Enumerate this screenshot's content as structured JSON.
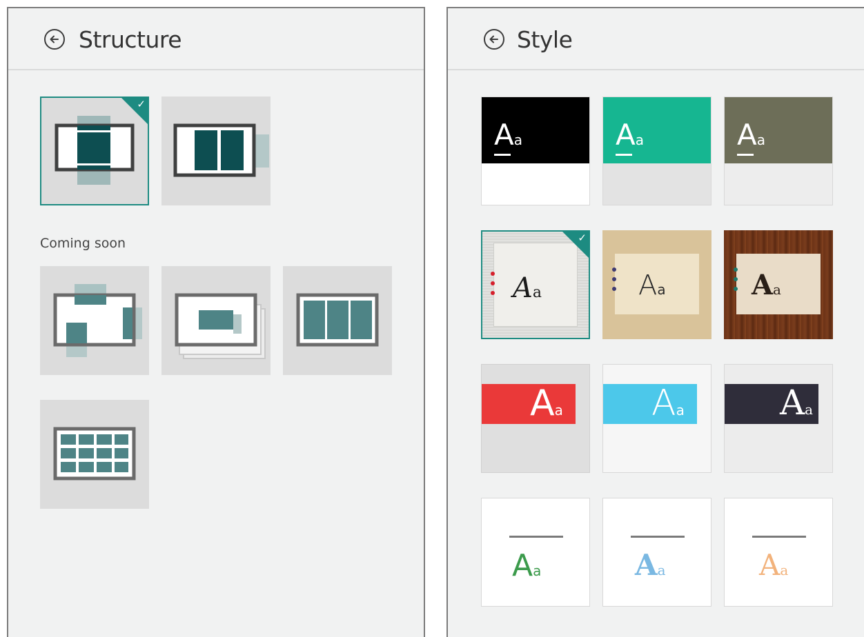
{
  "structure_panel": {
    "title": "Structure",
    "back_icon": "back-arrow-icon",
    "section_label": "Coming soon",
    "layouts": [
      {
        "name": "layout-vertical-center",
        "selected": true
      },
      {
        "name": "layout-horizontal-panels",
        "selected": false
      },
      {
        "name": "layout-scattered",
        "selected": false,
        "coming_soon": true
      },
      {
        "name": "layout-stacked",
        "selected": false,
        "coming_soon": true
      },
      {
        "name": "layout-three-columns",
        "selected": false,
        "coming_soon": true
      },
      {
        "name": "layout-grid",
        "selected": false,
        "coming_soon": true
      }
    ]
  },
  "style_panel": {
    "title": "Style",
    "back_icon": "back-arrow-icon",
    "check_mark": "✓",
    "sample_big": "A",
    "sample_small": "a",
    "styles": [
      {
        "name": "style-black",
        "header_color": "#000000"
      },
      {
        "name": "style-teal",
        "header_color": "#16b691"
      },
      {
        "name": "style-olive",
        "header_color": "#6d6e58"
      },
      {
        "name": "style-paper",
        "selected": true,
        "dot_color": "#d61f2b"
      },
      {
        "name": "style-craft",
        "dot_color": "#3e3b73"
      },
      {
        "name": "style-wood",
        "dot_color": "#1a7a6c"
      },
      {
        "name": "style-red-banner",
        "banner_color": "#ea3939"
      },
      {
        "name": "style-blue-banner",
        "banner_color": "#4cc8ea"
      },
      {
        "name": "style-dark-banner",
        "banner_color": "#2f2d3a"
      },
      {
        "name": "style-green-text",
        "text_color": "#3c9b4c"
      },
      {
        "name": "style-blue-text",
        "text_color": "#7ab8e2"
      },
      {
        "name": "style-orange-text",
        "text_color": "#f2b27b"
      }
    ]
  }
}
